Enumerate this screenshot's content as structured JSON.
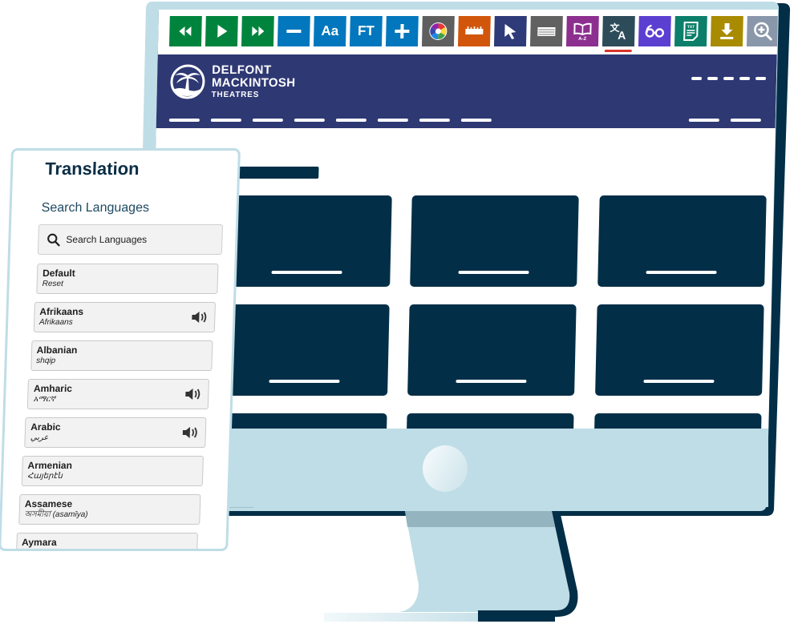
{
  "toolbar": {
    "buttons": [
      {
        "name": "rewind",
        "label": "",
        "icon": "rewind-icon",
        "color": "#00843d"
      },
      {
        "name": "play",
        "label": "",
        "icon": "play-icon",
        "color": "#00843d"
      },
      {
        "name": "fast-forward",
        "label": "",
        "icon": "fast-forward-icon",
        "color": "#00843d"
      },
      {
        "name": "decrease-text",
        "label": "",
        "icon": "minus-icon",
        "color": "#0277bd"
      },
      {
        "name": "font-size",
        "label": "Aa",
        "icon": "",
        "color": "#0277bd"
      },
      {
        "name": "font-type",
        "label": "FT",
        "icon": "",
        "color": "#0277bd"
      },
      {
        "name": "increase-text",
        "label": "",
        "icon": "plus-icon",
        "color": "#0277bd"
      },
      {
        "name": "color-wheel",
        "label": "",
        "icon": "color-wheel-icon",
        "color": "#5f5f5f"
      },
      {
        "name": "ruler",
        "label": "",
        "icon": "ruler-icon",
        "color": "#d1560b"
      },
      {
        "name": "cursor",
        "label": "",
        "icon": "cursor-icon",
        "color": "#2e3b78"
      },
      {
        "name": "screen-mask",
        "label": "",
        "icon": "screen-mask-icon",
        "color": "#616161"
      },
      {
        "name": "dictionary",
        "label": "",
        "icon": "dictionary-icon",
        "color": "#8c2f8f"
      },
      {
        "name": "translate",
        "label": "",
        "icon": "translate-icon",
        "color": "#2d4c5a",
        "active": true
      },
      {
        "name": "reading-glasses",
        "label": "",
        "icon": "glasses-icon",
        "color": "#5b3fd1"
      },
      {
        "name": "text-file",
        "label": "",
        "icon": "txt-file-icon",
        "color": "#0b7f6a"
      },
      {
        "name": "download",
        "label": "",
        "icon": "download-icon",
        "color": "#a88b00"
      },
      {
        "name": "magnifier",
        "label": "",
        "icon": "zoom-in-icon",
        "color": "#8a97aa"
      }
    ]
  },
  "site": {
    "logo": {
      "line1": "DELFONT",
      "line2": "MACKINTOSH",
      "line3": "THEATRES"
    },
    "header_color": "#2e3873",
    "card_color": "#032e47"
  },
  "translation": {
    "title": "Translation",
    "search_label": "Search Languages",
    "search_placeholder": "Search Languages",
    "languages": [
      {
        "name": "Default",
        "native": "Reset",
        "audio": false
      },
      {
        "name": "Afrikaans",
        "native": "Afrikaans",
        "audio": true
      },
      {
        "name": "Albanian",
        "native": "shqip",
        "audio": false
      },
      {
        "name": "Amharic",
        "native": "አማርኛ",
        "audio": true
      },
      {
        "name": "Arabic",
        "native": "عربي",
        "audio": true
      },
      {
        "name": "Armenian",
        "native": "Հայերէն",
        "audio": false
      },
      {
        "name": "Assamese",
        "native": "অসমীয়া (asamīya)",
        "audio": false
      },
      {
        "name": "Aymara",
        "native": "",
        "audio": false
      }
    ]
  }
}
